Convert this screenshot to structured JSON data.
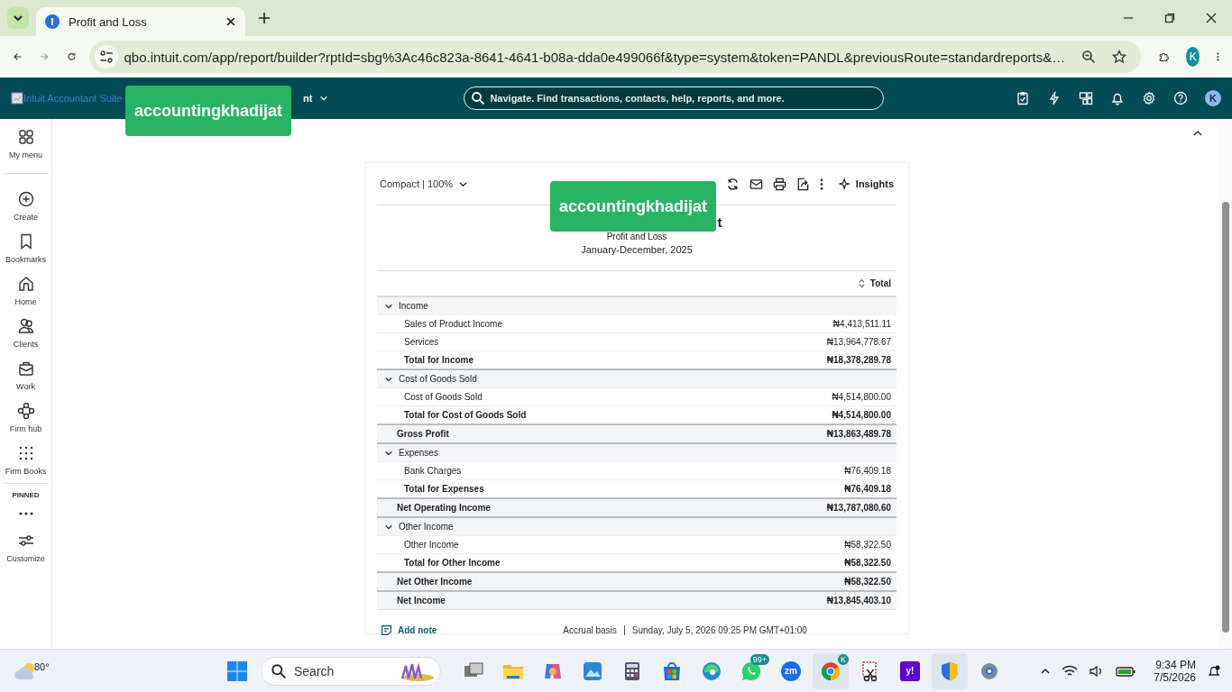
{
  "browser": {
    "tab_title": "Profit and Loss",
    "url": "qbo.intuit.com/app/report/builder?rptId=sbg%3Ac46c823a-8641-4641-b08a-dda0e499066f&type=system&token=PANDL&previousRoute=standardreports&…",
    "profile_initial": "K"
  },
  "app_header": {
    "logo_alt": "Intuit Accountant Suite",
    "company_visible": "nt",
    "search_placeholder": "Navigate. Find transactions, contacts, help, reports, and more.",
    "avatar": "K"
  },
  "sidebar": {
    "items": [
      {
        "label": "My menu"
      },
      {
        "label": "Create"
      },
      {
        "label": "Bookmarks"
      },
      {
        "label": "Home"
      },
      {
        "label": "Clients"
      },
      {
        "label": "Work"
      },
      {
        "label": "Firm hub"
      },
      {
        "label": "Firm Books"
      }
    ],
    "pinned_label": "PINNED",
    "customize_label": "Customize"
  },
  "report": {
    "view_label": "Compact | 100%",
    "insights_label": "Insights",
    "title_visible": "t",
    "subtitle": "Profit and Loss",
    "period": "January-December, 2025",
    "column_header": "Total",
    "rows": [
      {
        "kind": "section",
        "label": "Income",
        "expanded": true
      },
      {
        "kind": "item",
        "label": "Sales of Product Income",
        "amount": "₦4,413,511.11"
      },
      {
        "kind": "item",
        "label": "Services",
        "amount": "₦13,964,778.67"
      },
      {
        "kind": "total",
        "label": "Total for Income",
        "amount": "₦18,378,289.78"
      },
      {
        "kind": "section",
        "label": "Cost of Goods Sold",
        "expanded": true
      },
      {
        "kind": "item",
        "label": "Cost of Goods Sold",
        "amount": "₦4,514,800.00"
      },
      {
        "kind": "total",
        "label": "Total for Cost of Goods Sold",
        "amount": "₦4,514,800.00"
      },
      {
        "kind": "summary",
        "label": "Gross Profit",
        "amount": "₦13,863,489.78"
      },
      {
        "kind": "section",
        "label": "Expenses",
        "expanded": true
      },
      {
        "kind": "item",
        "label": "Bank Charges",
        "amount": "₦76,409.18"
      },
      {
        "kind": "total",
        "label": "Total for Expenses",
        "amount": "₦76,409.18"
      },
      {
        "kind": "summary",
        "label": "Net Operating Income",
        "amount": "₦13,787,080.60"
      },
      {
        "kind": "section",
        "label": "Other Income",
        "expanded": true
      },
      {
        "kind": "item",
        "label": "Other Income",
        "amount": "₦58,322.50"
      },
      {
        "kind": "total",
        "label": "Total for Other Income",
        "amount": "₦58,322.50"
      },
      {
        "kind": "summary",
        "label": "Net Other Income",
        "amount": "₦58,322.50"
      },
      {
        "kind": "summary",
        "label": "Net Income",
        "amount": "₦13,845,403.10"
      }
    ],
    "add_note": "Add note",
    "basis": "Accrual basis",
    "timestamp": "Sunday, July 5, 2026 09:25 PM GMT+01:00"
  },
  "overlay_labels": [
    {
      "text": "accountingkhadijat"
    },
    {
      "text": "accountingkhadijat"
    }
  ],
  "taskbar": {
    "weather": "80°",
    "search_placeholder": "Search",
    "apps": [
      {
        "active": false
      },
      {
        "active": false
      },
      {
        "active": false
      },
      {
        "active": false
      },
      {
        "active": false
      },
      {
        "active": false
      },
      {
        "active": false
      },
      {
        "active": false,
        "badge": "99+"
      },
      {
        "active": false,
        "label": "zm"
      },
      {
        "active": true,
        "badge": "K"
      },
      {
        "active": false
      },
      {
        "active": false,
        "label": "y!"
      },
      {
        "active": true
      },
      {
        "active": false
      }
    ],
    "time": "9:34 PM",
    "date": "7/5/2026"
  }
}
